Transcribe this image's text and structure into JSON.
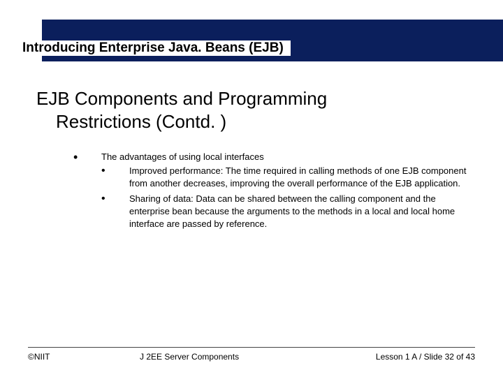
{
  "header": {
    "module_title": "Introducing Enterprise Java. Beans (EJB)"
  },
  "body": {
    "title_line1": "EJB Components and Programming",
    "title_line2": "Restrictions (Contd. )",
    "bullet_intro": "The advantages of using local interfaces",
    "subpoints": [
      "Improved performance: The time required in calling methods of one EJB component from another decreases, improving the overall performance of the EJB application.",
      "Sharing of data: Data can be shared between the calling component and the enterprise bean because the arguments to the methods in a local and local home interface are passed by reference."
    ]
  },
  "footer": {
    "left": "©NIIT",
    "center": "J 2EE Server Components",
    "right": "Lesson 1 A / Slide 32 of 43"
  }
}
